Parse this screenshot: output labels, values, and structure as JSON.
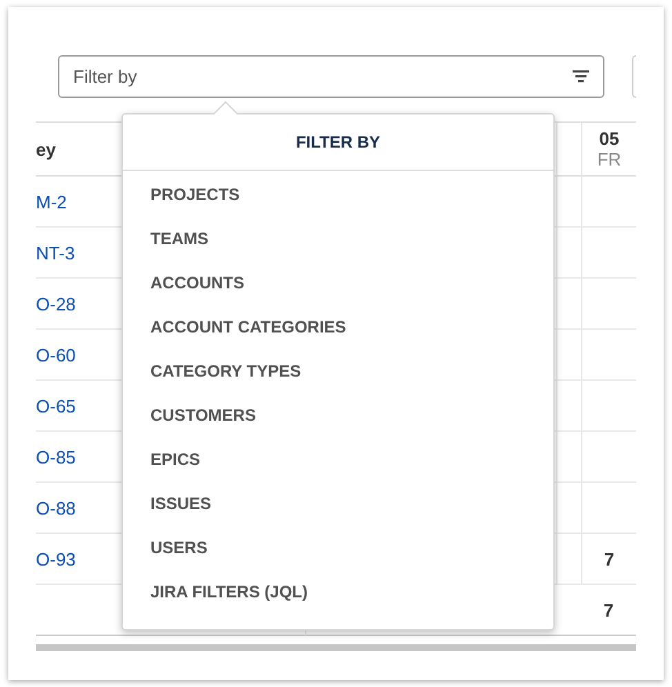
{
  "filter": {
    "placeholder": "Filter by"
  },
  "table": {
    "columns": [
      {
        "label": "ey"
      },
      {
        "label": "05",
        "sub": "FR"
      }
    ],
    "rows": [
      {
        "key": "M-2",
        "value": ""
      },
      {
        "key": "NT-3",
        "value": ""
      },
      {
        "key": "O-28",
        "value": ""
      },
      {
        "key": "O-60",
        "value": ""
      },
      {
        "key": "O-65",
        "value": ""
      },
      {
        "key": "O-85",
        "value": ""
      },
      {
        "key": "O-88",
        "value": ""
      },
      {
        "key": "O-93",
        "value": "7"
      }
    ],
    "total": "7"
  },
  "dropdown": {
    "title": "FILTER BY",
    "items": [
      "PROJECTS",
      "TEAMS",
      "ACCOUNTS",
      "ACCOUNT CATEGORIES",
      "CATEGORY TYPES",
      "CUSTOMERS",
      "EPICS",
      "ISSUES",
      "USERS",
      "JIRA FILTERS (JQL)"
    ]
  }
}
